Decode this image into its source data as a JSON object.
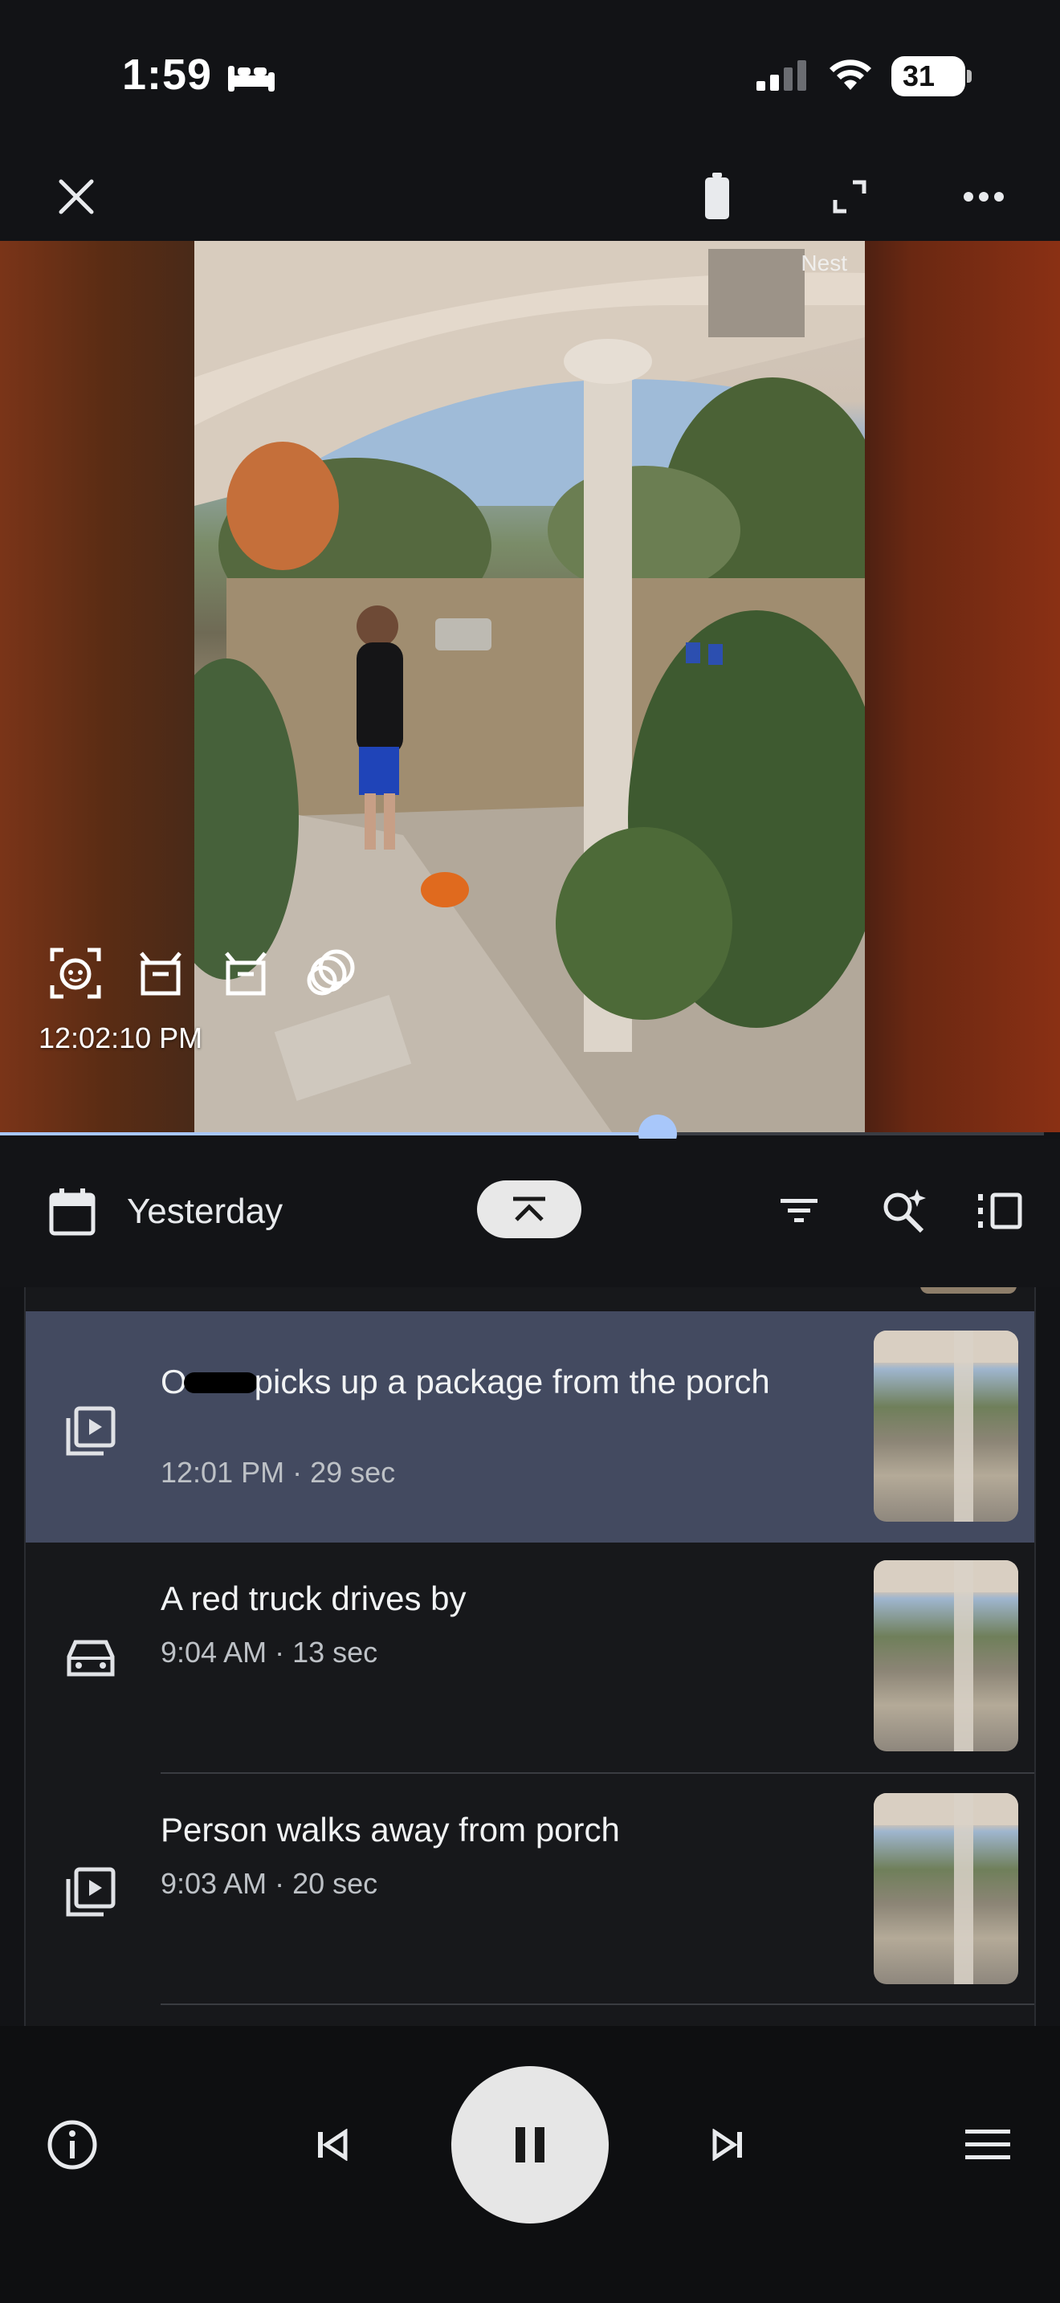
{
  "status_bar": {
    "time": "1:59",
    "battery": "31"
  },
  "video": {
    "brand_label": "Nest",
    "timestamp": "12:02:10 PM",
    "progress": 0.63
  },
  "timeline": {
    "date": "Yesterday"
  },
  "events": [
    {
      "title_pre": "O",
      "title_post": "picks up a package from the porch",
      "meta": "12:01 PM · 29 sec",
      "icon": "video-clip-icon",
      "active": true
    },
    {
      "title": "A red truck drives by",
      "meta": "9:04 AM · 13 sec",
      "icon": "car-icon",
      "active": false
    },
    {
      "title": "Person walks away from porch",
      "meta": "9:03 AM · 20 sec",
      "icon": "video-clip-icon",
      "active": false
    }
  ],
  "colors": {
    "accent": "#a8c7fa",
    "active_row": "#434a60",
    "background": "#121316"
  }
}
